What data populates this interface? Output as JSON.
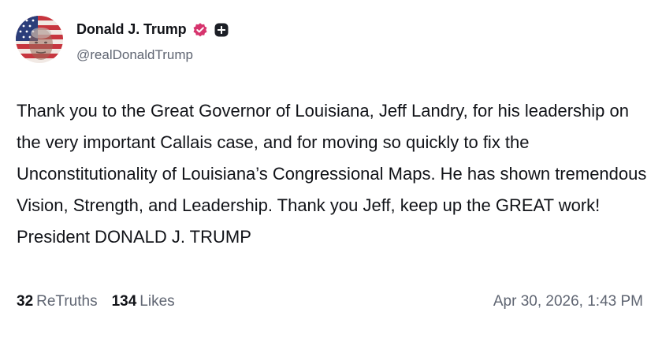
{
  "author": {
    "display_name": "Donald J. Trump",
    "handle": "@realDonaldTrump",
    "avatar_icon": "profile-photo-flag-avatar",
    "verified_icon": "verified-badge-icon",
    "plus_icon": "plus-badge-icon",
    "verified_color": "#d6346d"
  },
  "post": {
    "text": "Thank you to the Great Governor of Louisiana, Jeff Landry, for his leadership on the very important Callais case, and for moving so quickly to fix the Unconstitutionality of Louisiana’s Congressional Maps. He has shown tremendous Vision, Strength, and Leadership. Thank you Jeff, keep up the GREAT work! President DONALD J. TRUMP"
  },
  "stats": {
    "retruths_count": "32",
    "retruths_label": "ReTruths",
    "likes_count": "134",
    "likes_label": "Likes"
  },
  "timestamp": "Apr 30, 2026, 1:43 PM"
}
